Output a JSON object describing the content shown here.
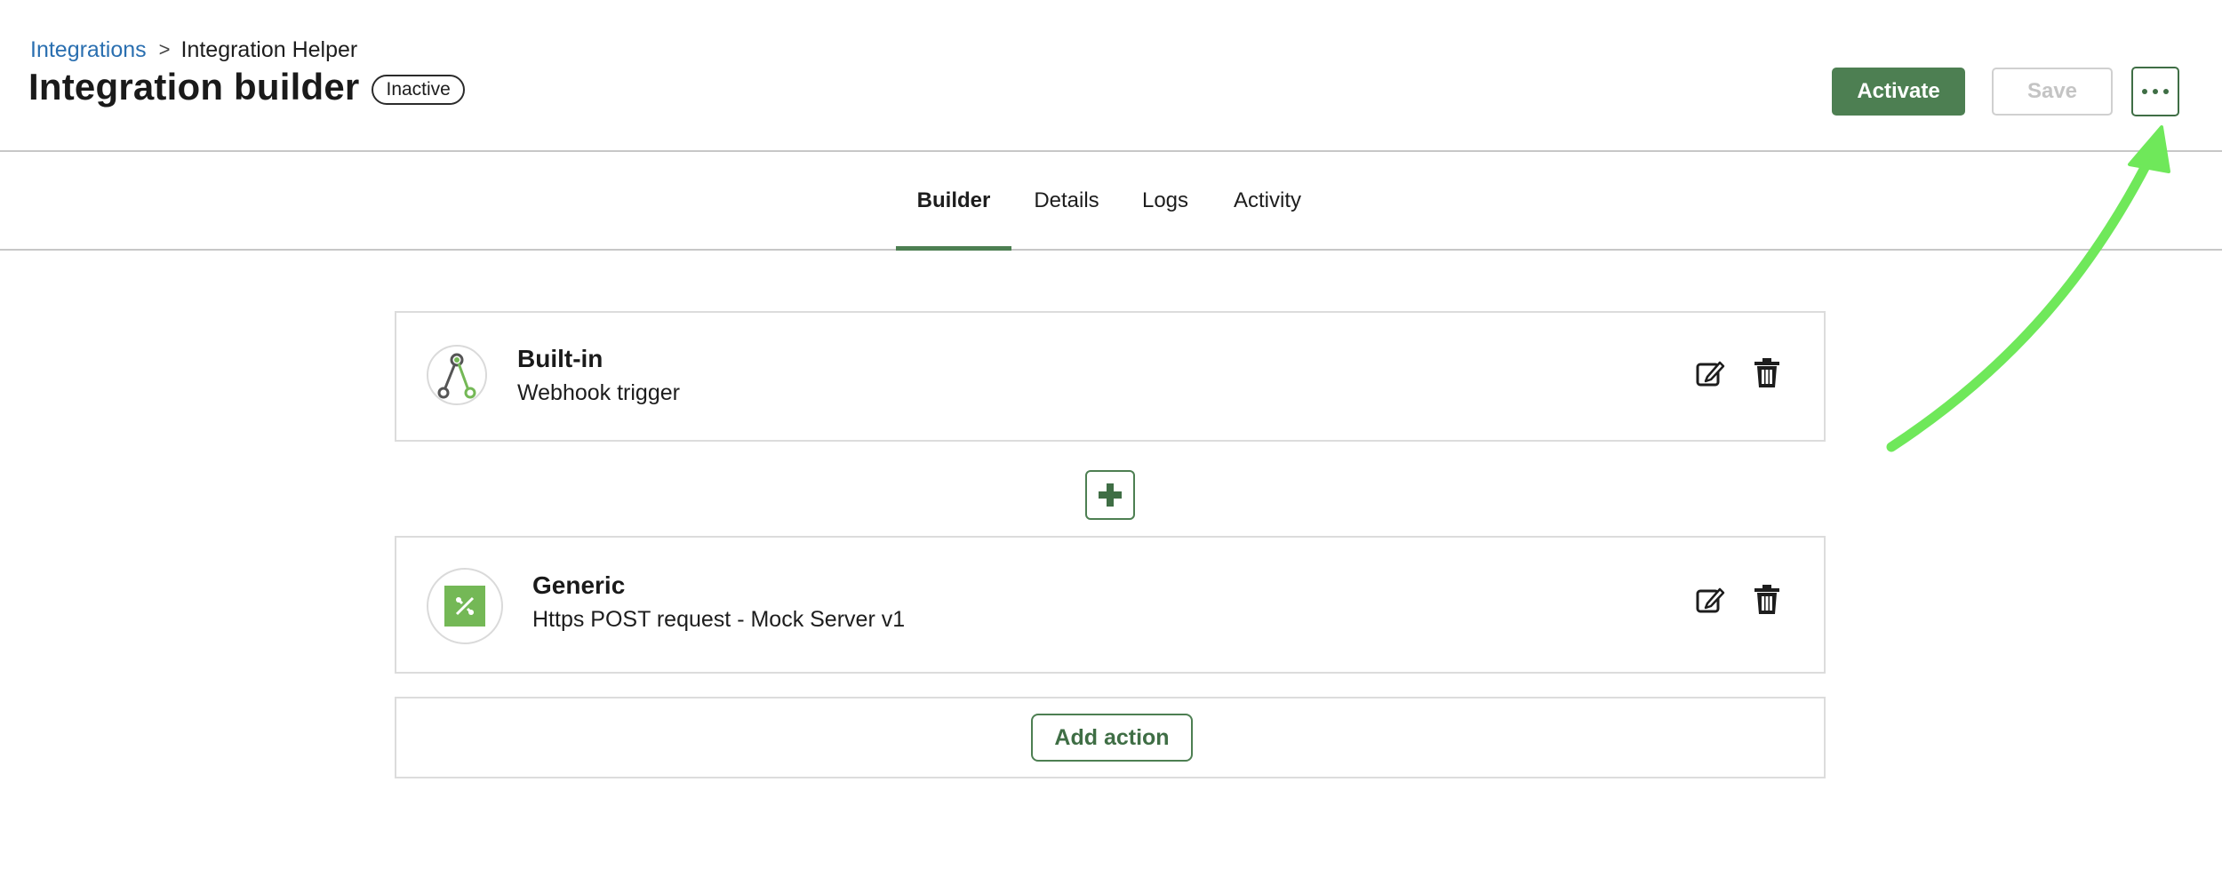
{
  "breadcrumb": {
    "parent": "Integrations",
    "separator": ">",
    "current": "Integration Helper"
  },
  "header": {
    "title": "Integration builder",
    "status": "Inactive",
    "activate_label": "Activate",
    "save_label": "Save",
    "more_icon": "ellipsis-icon"
  },
  "tabs": [
    {
      "label": "Builder",
      "active": true
    },
    {
      "label": "Details",
      "active": false
    },
    {
      "label": "Logs",
      "active": false
    },
    {
      "label": "Activity",
      "active": false
    }
  ],
  "steps": [
    {
      "title": "Built-in",
      "subtitle": "Webhook trigger",
      "icon": "webhook-icon"
    },
    {
      "title": "Generic",
      "subtitle": "Https POST request - Mock Server v1",
      "icon": "generic-connector-icon"
    }
  ],
  "add_step_icon": "plus-icon",
  "add_action_label": "Add action",
  "colors": {
    "accent": "#4d7f52",
    "link": "#2a6fb0",
    "annotation_arrow": "#6fe85a"
  }
}
